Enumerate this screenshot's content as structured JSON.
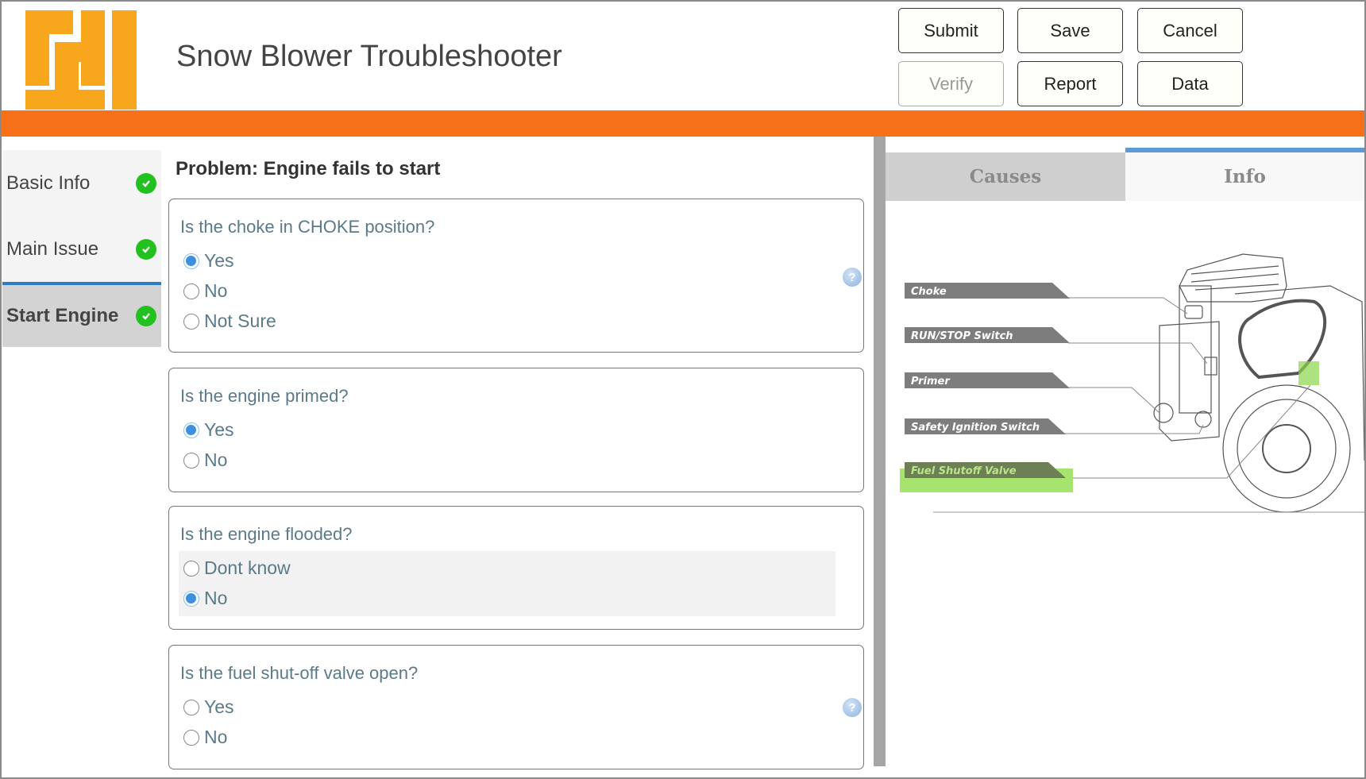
{
  "header": {
    "title": "Snow Blower Troubleshooter",
    "logo_text": "FH"
  },
  "toolbar": {
    "submit": "Submit",
    "save": "Save",
    "cancel": "Cancel",
    "verify": "Verify",
    "report": "Report",
    "data": "Data"
  },
  "sidebar": {
    "items": [
      {
        "label": "Basic Info",
        "status": "complete"
      },
      {
        "label": "Main Issue",
        "status": "complete"
      },
      {
        "label": "Start Engine",
        "status": "complete",
        "active": true
      }
    ]
  },
  "main": {
    "problem_title": "Problem: Engine fails to start",
    "questions": [
      {
        "text": "Is the choke in CHOKE position?",
        "options": [
          "Yes",
          "No",
          "Not Sure"
        ],
        "selected": "Yes",
        "help": true
      },
      {
        "text": "Is the engine primed?",
        "options": [
          "Yes",
          "No"
        ],
        "selected": "Yes"
      },
      {
        "text": "Is the engine flooded?",
        "options": [
          "Dont know",
          "No"
        ],
        "selected": "No"
      },
      {
        "text": "Is the fuel shut-off valve open?",
        "options": [
          "Yes",
          "No"
        ],
        "selected": null,
        "help": true
      }
    ]
  },
  "right_panel": {
    "tabs": [
      {
        "label": "Causes"
      },
      {
        "label": "Info",
        "active": true
      }
    ],
    "diagram_labels": [
      "Choke",
      "RUN/STOP Switch",
      "Primer",
      "Safety Ignition Switch",
      "Fuel Shutoff Valve"
    ],
    "highlighted_label": "Fuel Shutoff Valve"
  },
  "colors": {
    "brand_orange": "#f7711b",
    "logo": "#f8a61c",
    "accent_blue": "#2f7bc4",
    "check_green": "#22c11f",
    "highlight_green": "#9ee06a"
  }
}
